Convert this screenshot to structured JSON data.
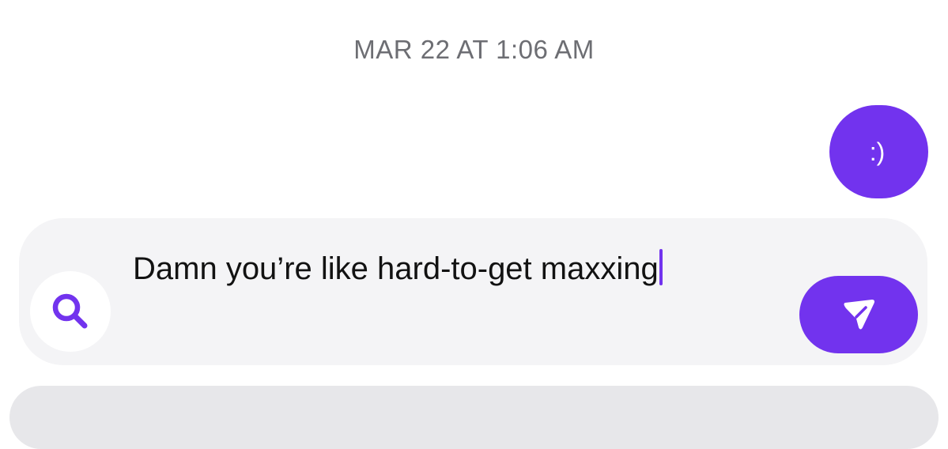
{
  "conversation": {
    "timestamp": "MAR 22 AT 1:06 AM",
    "messages": [
      {
        "direction": "outgoing",
        "text": ":)"
      }
    ]
  },
  "composer": {
    "text": "Damn you’re like hard-to-get maxxing",
    "search_icon": "search-icon",
    "send_icon": "send-icon"
  },
  "colors": {
    "accent": "#7233ee",
    "composer_bg": "#f4f4f6",
    "timestamp": "#6d6e73"
  }
}
